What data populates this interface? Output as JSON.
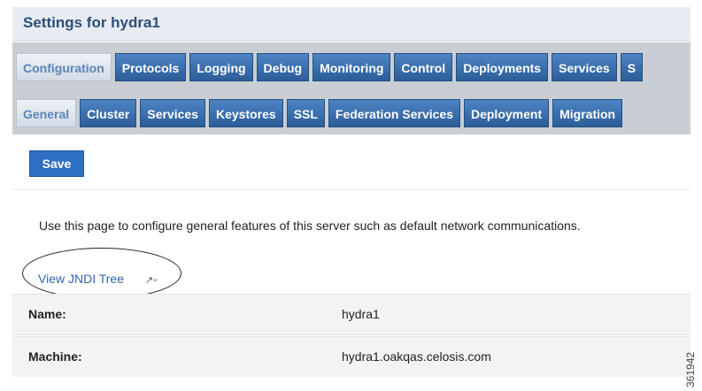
{
  "header": {
    "title": "Settings for hydra1"
  },
  "tabs_primary": [
    {
      "label": "Configuration",
      "active": true
    },
    {
      "label": "Protocols"
    },
    {
      "label": "Logging"
    },
    {
      "label": "Debug"
    },
    {
      "label": "Monitoring"
    },
    {
      "label": "Control"
    },
    {
      "label": "Deployments"
    },
    {
      "label": "Services"
    },
    {
      "label": "S"
    }
  ],
  "tabs_secondary": [
    {
      "label": "General",
      "active": true
    },
    {
      "label": "Cluster"
    },
    {
      "label": "Services"
    },
    {
      "label": "Keystores"
    },
    {
      "label": "SSL"
    },
    {
      "label": "Federation Services"
    },
    {
      "label": "Deployment"
    },
    {
      "label": "Migration"
    }
  ],
  "toolbar": {
    "save_label": "Save"
  },
  "main": {
    "description": "Use this page to configure general features of this server such as default network communications.",
    "jndi_link": "View JNDI Tree",
    "jndi_icon": "external-link-icon",
    "fields": [
      {
        "label": "Name:",
        "value": "hydra1"
      },
      {
        "label": "Machine:",
        "value": "hydra1.oakqas.celosis.com"
      }
    ]
  },
  "figure_id": "361942",
  "colors": {
    "accent": "#2e6fc4",
    "tab": "#3a6da5",
    "title": "#2b4e7a"
  }
}
